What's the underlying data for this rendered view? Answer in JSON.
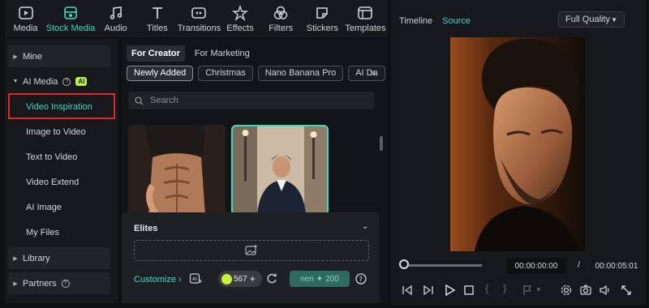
{
  "toolbar": {
    "items": [
      {
        "label": "Media",
        "icon": "media-icon"
      },
      {
        "label": "Stock Media",
        "icon": "stock-media-icon"
      },
      {
        "label": "Audio",
        "icon": "music-note-icon"
      },
      {
        "label": "Titles",
        "icon": "titles-icon"
      },
      {
        "label": "Transitions",
        "icon": "transitions-icon"
      },
      {
        "label": "Effects",
        "icon": "effects-icon"
      },
      {
        "label": "Filters",
        "icon": "filters-icon"
      },
      {
        "label": "Stickers",
        "icon": "stickers-icon"
      },
      {
        "label": "Templates",
        "icon": "templates-icon"
      }
    ],
    "active_index": 1
  },
  "sidebar": {
    "mine": "Mine",
    "ai_media": "AI Media",
    "ai_badge": "AI",
    "items": [
      "Video Inspiration",
      "Image to Video",
      "Text to Video",
      "Video Extend",
      "AI Image",
      "My Files"
    ],
    "library": "Library",
    "partners": "Partners"
  },
  "content": {
    "tabs": [
      "For Creator",
      "For Marketing"
    ],
    "chips": [
      "Newly Added",
      "Christmas",
      "Nano Banana Pro",
      "AI Da"
    ],
    "search_placeholder": "Search"
  },
  "elites": {
    "title": "Elites",
    "customize": "Customize",
    "credits": "567",
    "generate_label": "nen",
    "generate_cost": "200"
  },
  "preview": {
    "tabs": [
      "Timeline",
      "Source"
    ],
    "quality": "Full Quality",
    "current_time": "00:00:00:00",
    "separator": "/",
    "total_time": "00:00:05:01"
  },
  "colors": {
    "accent": "#3fd8c2",
    "highlight_box": "#e0262b",
    "ai_badge": "#b8f13d"
  }
}
